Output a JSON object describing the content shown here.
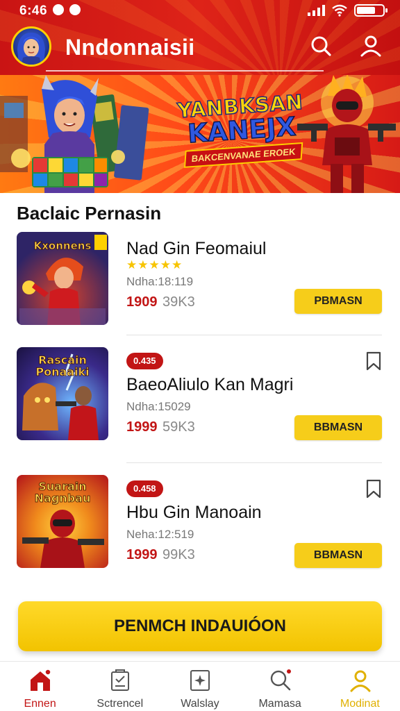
{
  "status_bar": {
    "time": "6:46"
  },
  "header": {
    "title": "Nndonnaisii"
  },
  "banner": {
    "headline_1": "YANBKSAN",
    "headline_2": "KANEJX",
    "subline": "BAKCENVANAE EROEK"
  },
  "section": {
    "title": "Baclaic Pernasin"
  },
  "games": [
    {
      "thumb_text": "Kxonnens",
      "tag": "",
      "name": "Nad Gin Feomaiul",
      "rating": "★★★★★",
      "subtitle": "Ndha:18:119",
      "price": "1909",
      "old_price": "39K3",
      "button": "PBMASN"
    },
    {
      "thumb_text": "Rascain Ponaaiki",
      "tag": "0.435",
      "name": "BaeoAliulo Kan Magri",
      "rating": "",
      "subtitle": "Ndha:15029",
      "price": "1999",
      "old_price": "59K3",
      "button": "BBMASN"
    },
    {
      "thumb_text": "Suarain Nagnbau",
      "tag": "0.458",
      "name": "Hbu Gin Manoain",
      "rating": "",
      "subtitle": "Neha:12:519",
      "price": "1999",
      "old_price": "99K3",
      "button": "BBMASN"
    }
  ],
  "cta": {
    "label": "PENMCH INDAUIÓON"
  },
  "nav": [
    {
      "label": "Ennen",
      "icon": "home-icon"
    },
    {
      "label": "Sctrencel",
      "icon": "clipboard-icon"
    },
    {
      "label": "Walslay",
      "icon": "sparkle-card-icon"
    },
    {
      "label": "Mamasa",
      "icon": "search-icon"
    },
    {
      "label": "Modinat",
      "icon": "profile-icon"
    }
  ],
  "colors": {
    "brand_red": "#c91414",
    "accent_yellow": "#f6cd1a"
  }
}
